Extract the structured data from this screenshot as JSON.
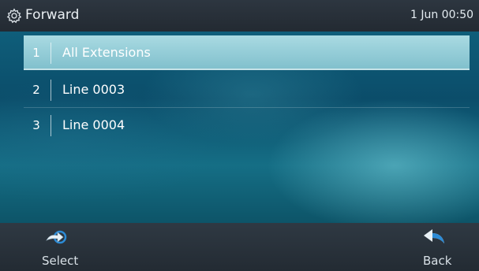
{
  "titlebar": {
    "icon": "gear-icon",
    "title": "Forward",
    "datetime": "1 Jun 00:50"
  },
  "list": {
    "selected_index": 0,
    "items": [
      {
        "number": "1",
        "label": "All Extensions"
      },
      {
        "number": "2",
        "label": "Line  0003"
      },
      {
        "number": "3",
        "label": "Line  0004"
      }
    ]
  },
  "softkeys": {
    "select": {
      "label": "Select",
      "icon": "select-arrow-icon"
    },
    "back": {
      "label": "Back",
      "icon": "back-arrow-icon"
    }
  },
  "colors": {
    "selected_row": "#a9dae2",
    "icon_blue": "#2c8bd6"
  }
}
